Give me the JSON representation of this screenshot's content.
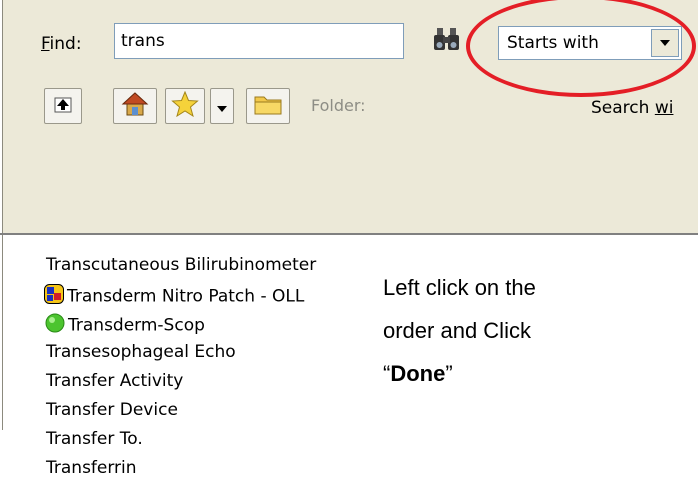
{
  "find": {
    "label": "Find:",
    "label_accelerator": "F",
    "label_rest": "ind:",
    "value": "trans"
  },
  "search_mode": {
    "selected": "Starts with"
  },
  "toolbar": {
    "folder_label": "Folder:",
    "search_within_label_prefix": "Search ",
    "search_within_label_accel": "wi"
  },
  "results": [
    {
      "label": "Transcutaneous Bilirubinometer",
      "icon": "none"
    },
    {
      "label": "Transderm Nitro Patch - OLL",
      "icon": "order-set-icon"
    },
    {
      "label": "Transderm-Scop",
      "icon": "green-dot-icon"
    },
    {
      "label": "Transesophageal Echo",
      "icon": "none"
    },
    {
      "label": "Transfer Activity",
      "icon": "none"
    },
    {
      "label": "Transfer Device",
      "icon": "none"
    },
    {
      "label": "Transfer To.",
      "icon": "none"
    },
    {
      "label": "Transferrin",
      "icon": "none"
    }
  ],
  "instruction": {
    "line1": "Left click on the",
    "line2": "order and Click",
    "quote_open": "“",
    "done": "Done",
    "quote_close": "”"
  },
  "colors": {
    "highlight_oval": "#e41e26",
    "panel_bg": "#ece9d8"
  }
}
